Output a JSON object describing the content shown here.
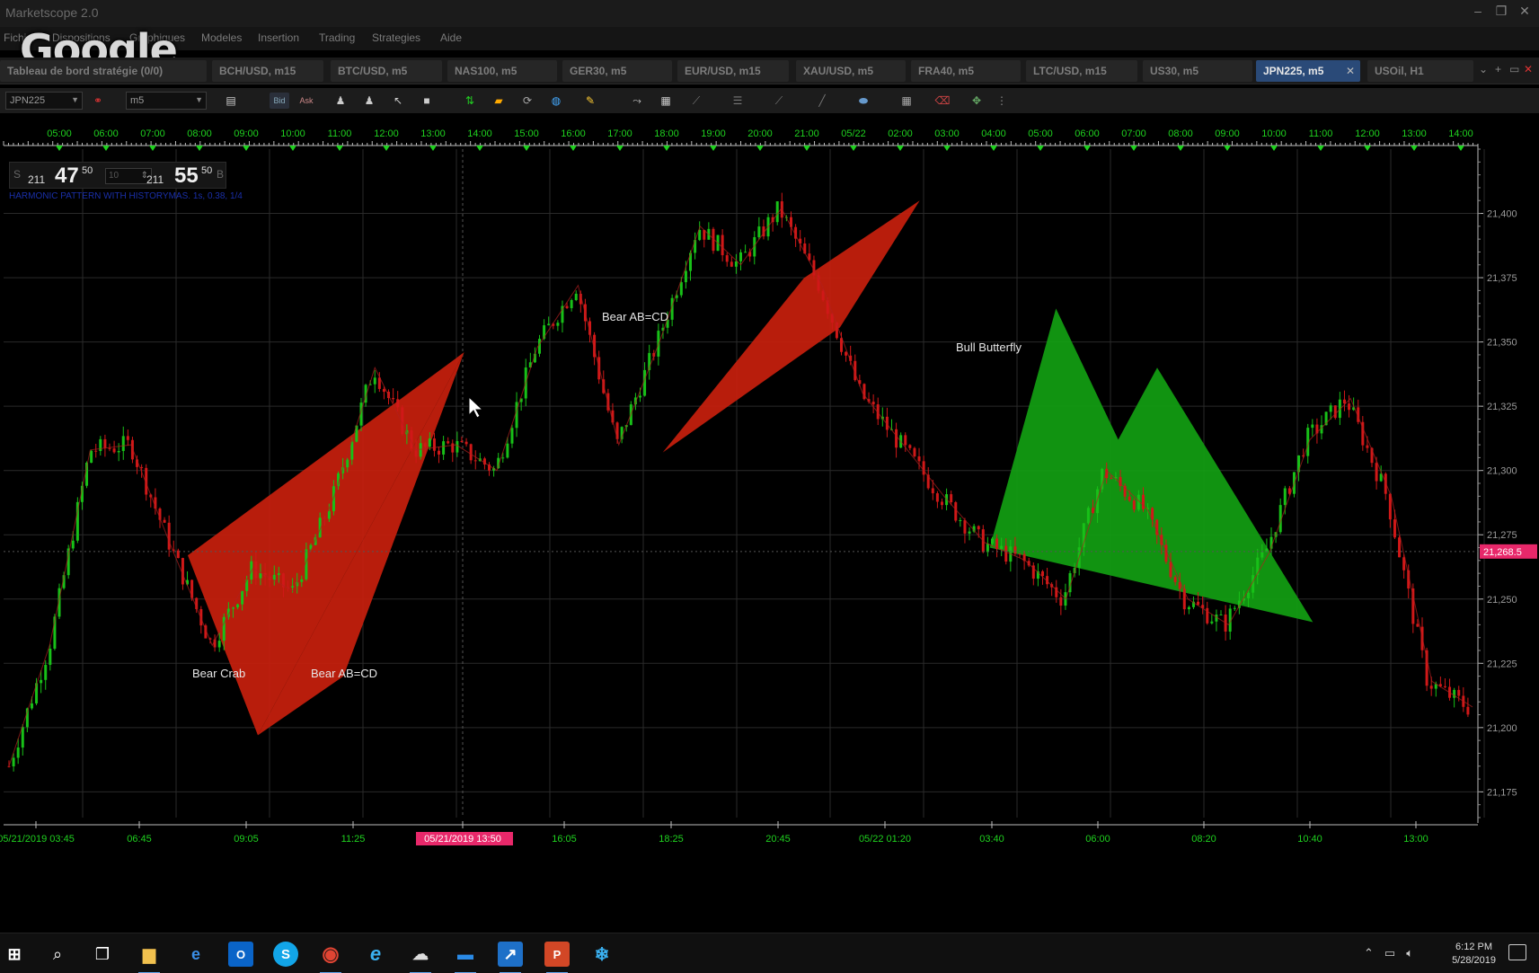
{
  "window": {
    "title": "Marketscope 2.0",
    "minimize": "–",
    "restore": "❐",
    "close": "✕"
  },
  "watermark": "Google",
  "menu": [
    "Fichier",
    "Dispositions",
    "Graphiques",
    "Modeles",
    "Insertion",
    "Trading",
    "Strategies",
    "Aide"
  ],
  "tabs": [
    "Tableau de bord stratégie (0/0)",
    "BCH/USD, m15",
    "BTC/USD, m5",
    "NAS100, m5",
    "GER30, m5",
    "EUR/USD, m15",
    "XAU/USD, m5",
    "FRA40, m5",
    "LTC/USD, m15",
    "US30, m5",
    "JPN225, m5",
    "USOil, H1"
  ],
  "active_tab": "JPN225, m5",
  "toolbar": {
    "symbol": "JPN225",
    "timeframe": "m5",
    "bid": "Bid",
    "ask": "Ask"
  },
  "price_panel": {
    "sell_label": "S",
    "buy_label": "B",
    "sell_prefix": "211",
    "sell_big": "47",
    "sell_sup": "50",
    "buy_prefix": "211",
    "buy_big": "55",
    "buy_sup": "50",
    "lot": "10"
  },
  "indicator_label": "HARMONIC PATTERN WITH HISTORYMAS. 1s, 0.38, 1/4",
  "colors": {
    "bear": "#c8200d",
    "bull": "#12a012",
    "up_candle": "#18c018",
    "down_candle": "#d01818",
    "grid": "#2a2a2a",
    "current_price": "#e8286a"
  },
  "chart_data": {
    "type": "candlestick",
    "instrument": "JPN225",
    "timeframe": "m5",
    "y_ticks": [
      "21,400",
      "21,375",
      "21,350",
      "21,325",
      "21,300",
      "21,275",
      "21,250",
      "21,225",
      "21,200",
      "21,175"
    ],
    "ylim": [
      21165,
      21425
    ],
    "current_price": "21,268.5",
    "top_axis_labels": [
      "05:00",
      "06:00",
      "07:00",
      "08:00",
      "09:00",
      "10:00",
      "11:00",
      "12:00",
      "13:00",
      "14:00",
      "15:00",
      "16:00",
      "17:00",
      "18:00",
      "19:00",
      "20:00",
      "21:00",
      "05/22",
      "02:00",
      "03:00",
      "04:00",
      "05:00",
      "06:00",
      "07:00",
      "08:00",
      "09:00",
      "10:00",
      "11:00",
      "12:00",
      "13:00",
      "14:00"
    ],
    "bottom_axis_labels": [
      "05/21/2019 03:45",
      "06:45",
      "09:05",
      "11:25",
      "05/21/2019 13:50",
      "16:05",
      "18:25",
      "20:45",
      "05/22 01:20",
      "03:40",
      "06:00",
      "08:20",
      "10:40",
      "13:00"
    ],
    "highlighted_time": "05/21/2019 13:50",
    "price_path": [
      21185,
      21232,
      21308,
      21310,
      21270,
      21232,
      21262,
      21253,
      21290,
      21340,
      21308,
      21310,
      21300,
      21348,
      21372,
      21310,
      21350,
      21395,
      21380,
      21402,
      21372,
      21330,
      21310,
      21290,
      21272,
      21265,
      21250,
      21300,
      21285,
      21250,
      21240,
      21268,
      21312,
      21328,
      21290,
      21218,
      21208
    ],
    "patterns": [
      {
        "name": "Bear Crab",
        "direction": "bear",
        "points": [
          [
            "05/21 07:45",
            21267
          ],
          [
            "05/21 09:15",
            21197
          ],
          [
            "05/21 13:40",
            21346
          ]
        ]
      },
      {
        "name": "Bear AB=CD",
        "direction": "bear",
        "points": [
          [
            "05/21 09:15",
            21197
          ],
          [
            "05/21 11:05",
            21220
          ],
          [
            "05/21 13:40",
            21346
          ]
        ]
      },
      {
        "name": "Bear AB=CD",
        "direction": "bear",
        "points": [
          [
            "05/21 17:55",
            21307
          ],
          [
            "05/22 01:25",
            21405
          ]
        ]
      },
      {
        "name": "Bull Butterfly",
        "direction": "bull",
        "points": [
          [
            "05/22 02:55",
            21270
          ],
          [
            "05/22 04:20",
            21363
          ],
          [
            "05/22 05:40",
            21312
          ],
          [
            "05/22 06:30",
            21340
          ],
          [
            "05/22 09:50",
            21241
          ]
        ]
      }
    ],
    "grid": true
  },
  "taskbar": {
    "clock_time": "6:12 PM",
    "clock_date": "5/28/2019",
    "apps": [
      "windows-start-icon",
      "search-icon",
      "task-view-icon",
      "file-explorer-icon",
      "edge-icon",
      "outlook-icon",
      "skype-icon",
      "chrome-icon",
      "internet-explorer-icon",
      "trading-app-icon",
      "window-app-icon",
      "marketscope-icon",
      "powerpoint-icon",
      "snowflake-app-icon"
    ]
  }
}
